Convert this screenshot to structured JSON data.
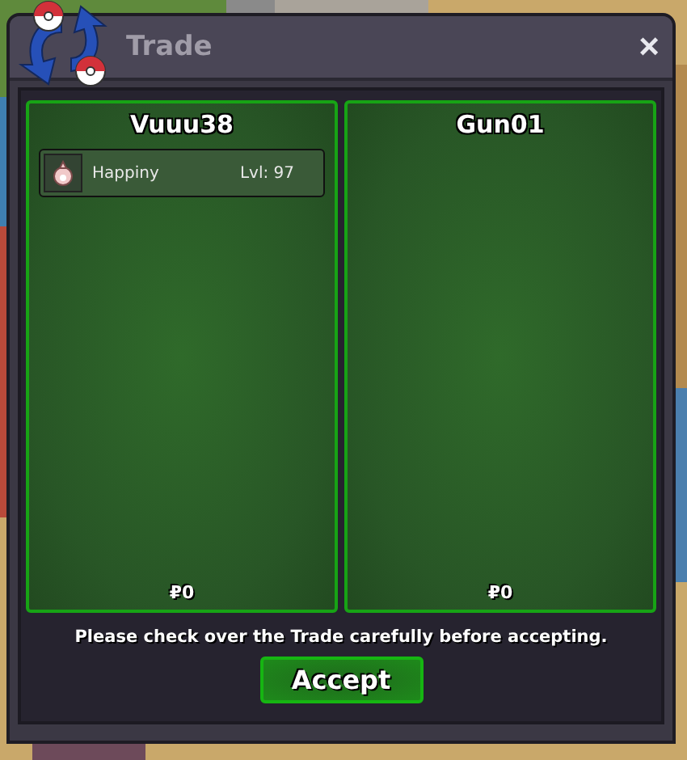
{
  "window": {
    "title": "Trade",
    "close": "×"
  },
  "offers": [
    {
      "player": "Vuuu38",
      "items": [
        {
          "name": "Happiny",
          "level": "Lvl: 97"
        }
      ],
      "money": "₽0"
    },
    {
      "player": "Gun01",
      "money": "₽0"
    }
  ],
  "message": "Please check over the Trade carefully before accepting.",
  "accept_button": "Accept"
}
